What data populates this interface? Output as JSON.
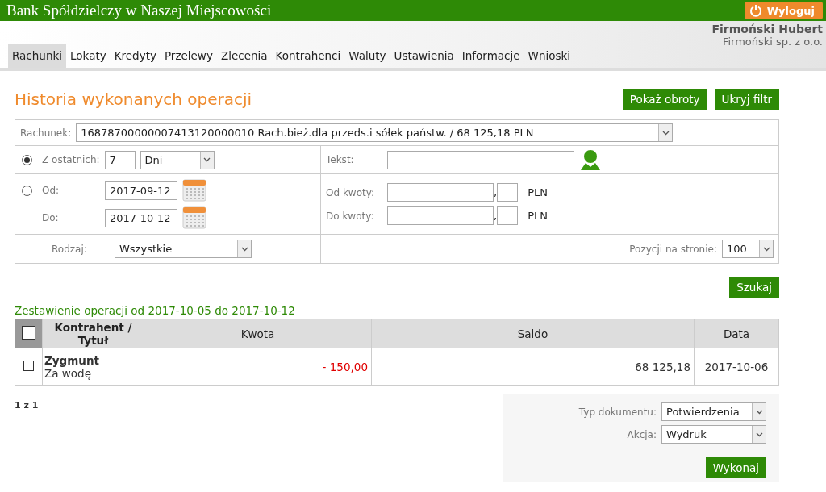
{
  "header": {
    "bank_name": "Bank Spółdzielczy w Naszej Miejscowości",
    "logout": "Wyloguj",
    "user_name": "Firmoński Hubert",
    "company": "Firmoński sp. z o.o."
  },
  "tabs": [
    {
      "label": "Rachunki",
      "selected": true
    },
    {
      "label": "Lokaty",
      "selected": false
    },
    {
      "label": "Kredyty",
      "selected": false
    },
    {
      "label": "Przelewy",
      "selected": false
    },
    {
      "label": "Zlecenia",
      "selected": false
    },
    {
      "label": "Kontrahenci",
      "selected": false
    },
    {
      "label": "Waluty",
      "selected": false
    },
    {
      "label": "Ustawienia",
      "selected": false
    },
    {
      "label": "Informacje",
      "selected": false
    },
    {
      "label": "Wnioski",
      "selected": false
    }
  ],
  "page_title": "Historia wykonanych operacji",
  "top_buttons": [
    "Pokaż obroty",
    "Ukryj filtr"
  ],
  "filter": {
    "account_label": "Rachunek:",
    "account_value": "16878700000007413120000010 Rach.bież.dla przeds.i sółek państw. / 68 125,18 PLN",
    "last_label": "Z ostatnich:",
    "last_selected": true,
    "last_value": "7",
    "last_unit": "Dni",
    "range_selected": false,
    "from_label": "Od:",
    "from_value": "2017-09-12",
    "to_label": "Do:",
    "to_value": "2017-10-12",
    "type_label": "Rodzaj:",
    "type_value": "Wszystkie",
    "text_label": "Tekst:",
    "amount_from_label": "Od kwoty:",
    "amount_to_label": "Do kwoty:",
    "currency_from": "PLN",
    "currency_to": "PLN",
    "separator_from": ",",
    "separator_to": ",",
    "per_page_label": "Pozycji na stronie:",
    "per_page_value": "100"
  },
  "search_button": "Szukaj",
  "summary_title": "Zestawienie operacji od 2017-10-05 do 2017-10-12",
  "table": {
    "select_all_checked": false,
    "columns": [
      "Kontrahent / Tytuł",
      "Kwota",
      "Saldo",
      "Data"
    ],
    "rows": [
      {
        "checked": false,
        "counterparty": "Zygmunt",
        "title": "Za wodę",
        "amount": "- 150,00",
        "balance": "68 125,18",
        "date": "2017-10-06"
      }
    ]
  },
  "pagination": "1 z 1",
  "actions": {
    "doc_type_label": "Typ dokumentu:",
    "doc_type_value": "Potwierdzenia",
    "action_label": "Akcja:",
    "action_value": "Wydruk",
    "execute": "Wykonaj"
  }
}
